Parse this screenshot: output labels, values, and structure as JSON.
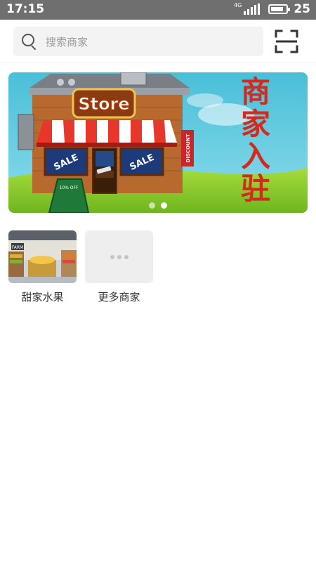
{
  "status_bar": {
    "time": "17:15",
    "network": "4G",
    "battery_level": "25"
  },
  "search": {
    "placeholder": "搜索商家",
    "icon": "search-icon",
    "scan_icon": "scan-icon"
  },
  "banner": {
    "store_sign": "Store",
    "sale_left": "SALE",
    "sale_right": "SALE",
    "discount_flag": "DISCOUNT",
    "chalkboard": "10% OFF",
    "side_title_chars": [
      "商",
      "家",
      "入",
      "驻"
    ],
    "slide_count": 2,
    "active_slide": 2
  },
  "merchants": [
    {
      "label": "甜家水果",
      "thumb_text": "FARM"
    },
    {
      "label": "更多商家"
    }
  ],
  "colors": {
    "status_bar": "#6f6f6f",
    "banner_sky": "#5fc9e0",
    "banner_grass": "#8fd134",
    "title_red": "#d42a1e"
  }
}
